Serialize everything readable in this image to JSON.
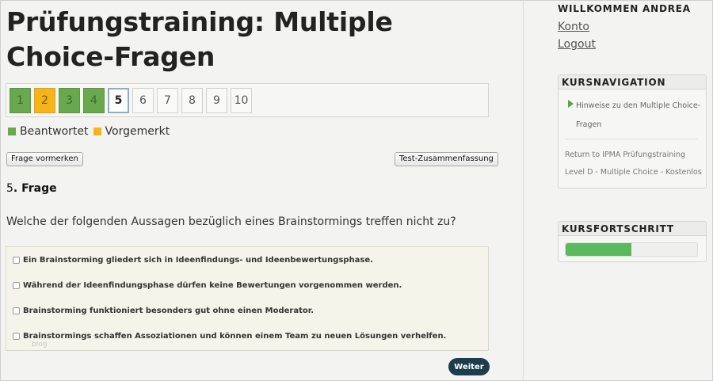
{
  "page": {
    "title": "Prüfungstraining: Multiple Choice-Fragen"
  },
  "question_nav": {
    "items": [
      {
        "label": "1",
        "state": "answered"
      },
      {
        "label": "2",
        "state": "marked"
      },
      {
        "label": "3",
        "state": "answered"
      },
      {
        "label": "4",
        "state": "answered"
      },
      {
        "label": "5",
        "state": "current"
      },
      {
        "label": "6",
        "state": "open"
      },
      {
        "label": "7",
        "state": "open"
      },
      {
        "label": "8",
        "state": "open"
      },
      {
        "label": "9",
        "state": "open"
      },
      {
        "label": "10",
        "state": "open"
      }
    ]
  },
  "legend": {
    "answered": "Beantwortet",
    "marked": "Vorgemerkt",
    "answered_color": "#6aa84f",
    "marked_color": "#f4b41a"
  },
  "buttons": {
    "mark": "Frage vormerken",
    "summary": "Test-Zusammenfassung",
    "next": "Weiter"
  },
  "question": {
    "number": "5",
    "label": ". Frage",
    "text": "Welche der folgenden Aussagen bezüglich eines Brainstormings treffen nicht zu?",
    "answers": [
      "Ein Brainstorming gliedert sich in Ideenfindungs- und Ideenbewertungsphase.",
      "Während der Ideenfindungsphase dürfen keine Bewertungen vorgenommen werden.",
      "Brainstorming funktioniert besonders gut ohne einen Moderator.",
      "Brainstormings schaffen Assoziationen und können einem Team zu neuen Lösungen verhelfen."
    ],
    "watermark": "blog"
  },
  "sidebar": {
    "welcome": "WILLKOMMEN ANDREA",
    "links": {
      "konto": "Konto",
      "logout": "Logout"
    },
    "course_nav": {
      "heading": "KURSNAVIGATION",
      "current_item": "Hinweise zu den Multiple Choice-Fragen",
      "return_link": "Return to IPMA Prüfungstraining Level D - Multiple Choice - Kostenlos"
    },
    "progress": {
      "heading": "KURSFORTSCHRITT",
      "fraction": 0.5,
      "color": "#5cb85c"
    }
  }
}
